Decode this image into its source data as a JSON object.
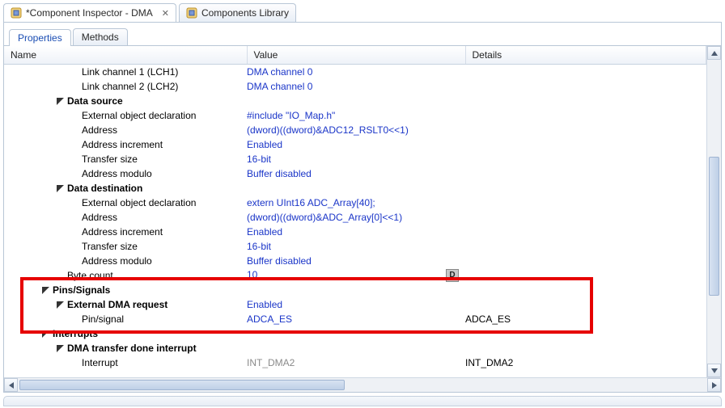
{
  "editor_tabs": [
    {
      "label": "*Component Inspector - DMA",
      "active": true,
      "closable": true
    },
    {
      "label": "Components Library",
      "active": false,
      "closable": false
    }
  ],
  "subtabs": [
    {
      "label": "Properties",
      "active": true
    },
    {
      "label": "Methods",
      "active": false
    }
  ],
  "columns": {
    "name": "Name",
    "value": "Value",
    "details": "Details"
  },
  "rows": [
    {
      "depth": 3,
      "expand": "",
      "name": "Link channel 1 (LCH1)",
      "value": "DMA channel 0",
      "vclass": "link",
      "details": ""
    },
    {
      "depth": 3,
      "expand": "",
      "name": "Link channel 2 (LCH2)",
      "value": "DMA channel 0",
      "vclass": "link",
      "details": ""
    },
    {
      "depth": 2,
      "expand": "open",
      "bold": true,
      "name": "Data source",
      "value": "",
      "vclass": "plain",
      "details": ""
    },
    {
      "depth": 3,
      "expand": "",
      "name": "External object declaration",
      "value": "#include \"IO_Map.h\"",
      "vclass": "link",
      "details": ""
    },
    {
      "depth": 3,
      "expand": "",
      "name": "Address",
      "value": "(dword)((dword)&ADC12_RSLT0<<1)",
      "vclass": "link",
      "details": ""
    },
    {
      "depth": 3,
      "expand": "",
      "name": "Address increment",
      "value": "Enabled",
      "vclass": "link",
      "details": ""
    },
    {
      "depth": 3,
      "expand": "",
      "name": "Transfer size",
      "value": "16-bit",
      "vclass": "link",
      "details": ""
    },
    {
      "depth": 3,
      "expand": "",
      "name": "Address modulo",
      "value": "Buffer disabled",
      "vclass": "link",
      "details": ""
    },
    {
      "depth": 2,
      "expand": "open",
      "bold": true,
      "name": "Data destination",
      "value": "",
      "vclass": "plain",
      "details": ""
    },
    {
      "depth": 3,
      "expand": "",
      "name": "External object declaration",
      "value": "extern UInt16 ADC_Array[40];",
      "vclass": "link",
      "details": ""
    },
    {
      "depth": 3,
      "expand": "",
      "name": "Address",
      "value": "(dword)((dword)&ADC_Array[0]<<1)",
      "vclass": "link",
      "details": ""
    },
    {
      "depth": 3,
      "expand": "",
      "name": "Address increment",
      "value": "Enabled",
      "vclass": "link",
      "details": ""
    },
    {
      "depth": 3,
      "expand": "",
      "name": "Transfer size",
      "value": "16-bit",
      "vclass": "link",
      "details": ""
    },
    {
      "depth": 3,
      "expand": "",
      "name": "Address modulo",
      "value": "Buffer disabled",
      "vclass": "link",
      "details": ""
    },
    {
      "depth": 2,
      "expand": "",
      "name": "Byte count",
      "value": "10",
      "vclass": "link",
      "details": "",
      "badge": "D"
    },
    {
      "depth": 1,
      "expand": "open",
      "bold": true,
      "name": "Pins/Signals",
      "value": "",
      "vclass": "plain",
      "details": ""
    },
    {
      "depth": 2,
      "expand": "open",
      "bold": true,
      "name": "External DMA request",
      "value": "Enabled",
      "vclass": "link",
      "details": ""
    },
    {
      "depth": 3,
      "expand": "",
      "name": "Pin/signal",
      "value": "ADCA_ES",
      "vclass": "link",
      "details": "ADCA_ES"
    },
    {
      "depth": 1,
      "expand": "open",
      "bold": true,
      "name": "Interrupts",
      "value": "",
      "vclass": "plain",
      "details": ""
    },
    {
      "depth": 2,
      "expand": "open",
      "bold": true,
      "name": "DMA transfer done interrupt",
      "value": "",
      "vclass": "plain",
      "details": ""
    },
    {
      "depth": 3,
      "expand": "",
      "name": "Interrupt",
      "value": "INT_DMA2",
      "vclass": "gray",
      "details": "INT_DMA2"
    }
  ]
}
